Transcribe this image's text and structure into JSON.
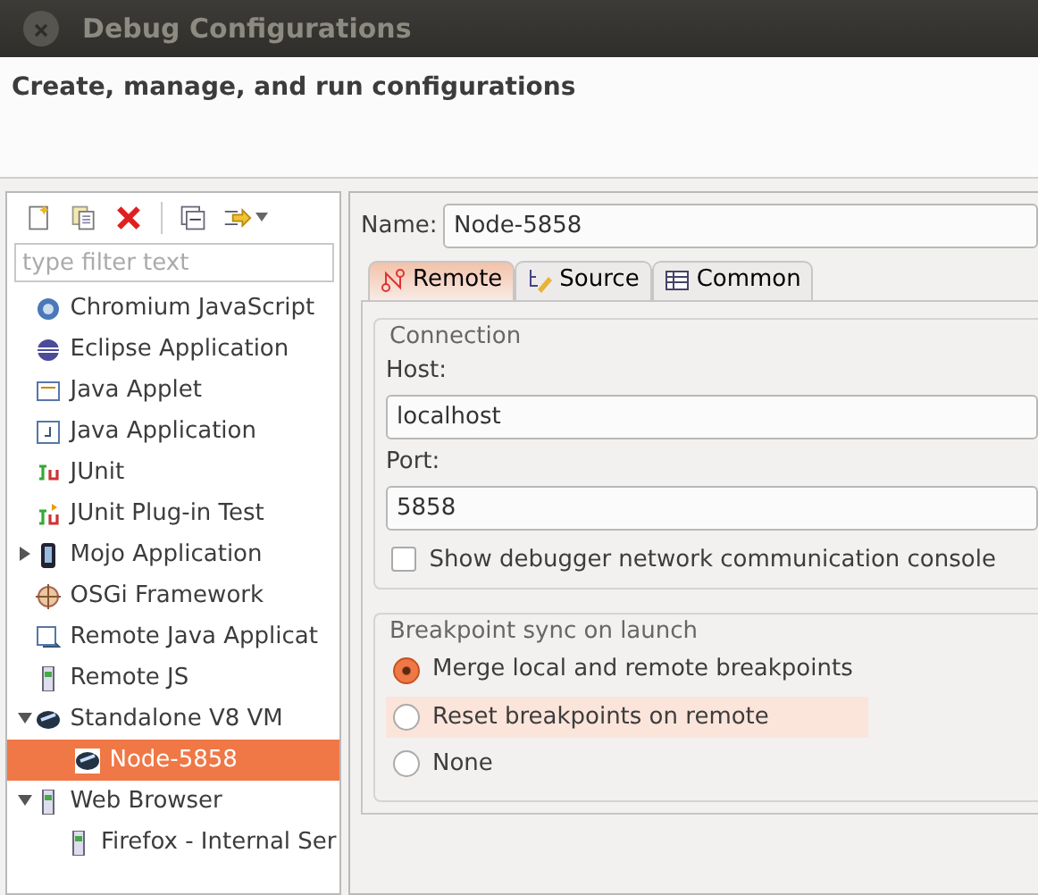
{
  "window": {
    "title": "Debug Configurations"
  },
  "header": {
    "title": "Create, manage, and run configurations"
  },
  "toolbar": {
    "buttons": [
      {
        "kind": "new"
      },
      {
        "kind": "duplicate"
      },
      {
        "kind": "delete"
      },
      {
        "kind": "collapse"
      },
      {
        "kind": "filter"
      }
    ]
  },
  "filter": {
    "placeholder": "type filter text"
  },
  "tree": [
    {
      "label": "Chromium JavaScript",
      "selected": false
    },
    {
      "label": "Eclipse Application",
      "selected": false
    },
    {
      "label": "Java Applet",
      "selected": false
    },
    {
      "label": "Java Application",
      "selected": false
    },
    {
      "label": "JUnit",
      "selected": false
    },
    {
      "label": "JUnit Plug-in Test",
      "selected": false
    },
    {
      "label": "Mojo Application",
      "selected": false,
      "expanded": false
    },
    {
      "label": "OSGi Framework",
      "selected": false
    },
    {
      "label": "Remote Java Applicat",
      "selected": false
    },
    {
      "label": "Remote JS",
      "selected": false
    },
    {
      "label": "Standalone V8 VM",
      "selected": false,
      "expanded": true,
      "children": [
        {
          "label": "Node-5858",
          "selected": true
        }
      ]
    },
    {
      "label": "Web Browser",
      "selected": false,
      "expanded": true,
      "children": [
        {
          "label": "Firefox - Internal Ser",
          "selected": false
        }
      ]
    }
  ],
  "name_field": {
    "label": "Name:",
    "value": "Node-5858"
  },
  "tabs": [
    {
      "label": "Remote",
      "selected": true
    },
    {
      "label": "Source",
      "selected": false
    },
    {
      "label": "Common",
      "selected": false
    }
  ],
  "connection": {
    "title": "Connection",
    "host_label": "Host:",
    "host": "localhost",
    "port_label": "Port:",
    "port": "5858",
    "console_checkbox": {
      "label": "Show debugger network communication console",
      "checked": false
    }
  },
  "breakpoint_sync": {
    "title": "Breakpoint sync on launch",
    "options": [
      {
        "label": "Merge local and remote breakpoints",
        "selected": true,
        "highlighted": false
      },
      {
        "label": "Reset breakpoints on remote",
        "selected": false,
        "highlighted": true
      },
      {
        "label": "None",
        "selected": false,
        "highlighted": false
      }
    ]
  }
}
